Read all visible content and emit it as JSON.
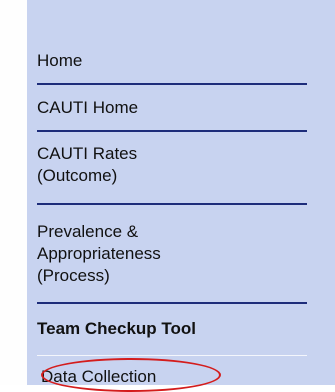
{
  "sidebar": {
    "items": [
      {
        "label_lines": [
          "Home"
        ]
      },
      {
        "label_lines": [
          "CAUTI Home"
        ]
      },
      {
        "label_lines": [
          "CAUTI Rates",
          "(Outcome)"
        ]
      },
      {
        "label_lines": [
          "Prevalence &",
          "Appropriateness",
          "(Process)"
        ]
      },
      {
        "label_lines": [
          "Team Checkup Tool"
        ]
      },
      {
        "label_lines": [
          "Data Collection"
        ]
      }
    ]
  },
  "annotation": {
    "highlight_color": "#d41c1c",
    "highlighted_item": "Data Collection"
  },
  "colors": {
    "sidebar_bg": "#c8d3f0",
    "divider": "#1d2c7a"
  }
}
